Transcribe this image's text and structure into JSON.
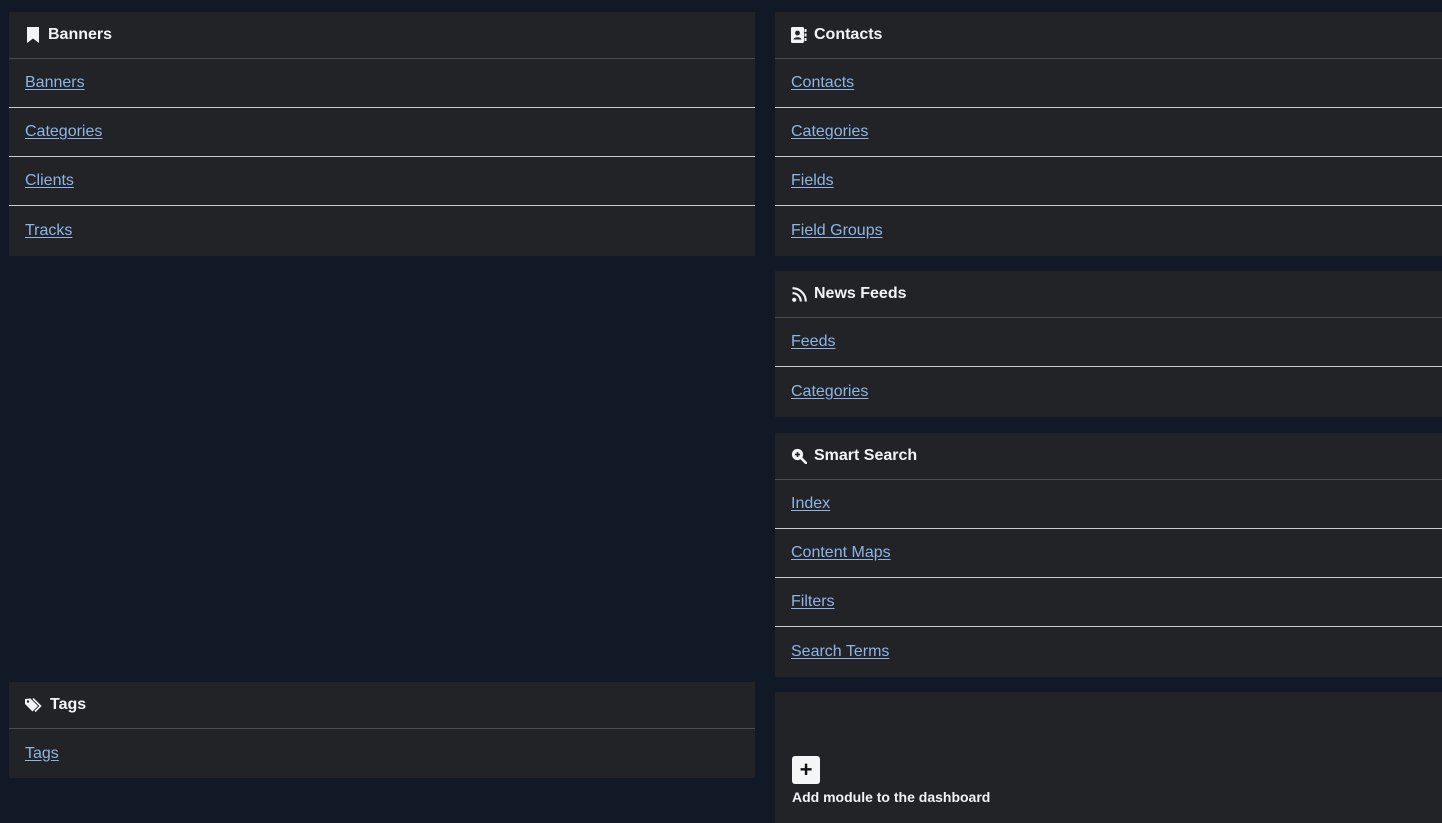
{
  "banners": {
    "title": "Banners",
    "icon": "bookmark-icon",
    "links": [
      "Banners",
      "Categories",
      "Clients",
      "Tracks"
    ]
  },
  "contacts": {
    "title": "Contacts",
    "icon": "address-book-icon",
    "links": [
      "Contacts",
      "Categories",
      "Fields",
      "Field Groups"
    ]
  },
  "newsfeeds": {
    "title": "News Feeds",
    "icon": "rss-icon",
    "links": [
      "Feeds",
      "Categories"
    ]
  },
  "smartsearch": {
    "title": "Smart Search",
    "icon": "search-plus-icon",
    "links": [
      "Index",
      "Content Maps",
      "Filters",
      "Search Terms"
    ]
  },
  "tags": {
    "title": "Tags",
    "icon": "tags-icon",
    "links": [
      "Tags"
    ]
  },
  "add_module": {
    "button_symbol": "+",
    "label": "Add module to the dashboard"
  },
  "colors": {
    "background": "#111927",
    "card": "#212327",
    "link": "#8fb4e6",
    "text": "#f2f3f5"
  }
}
